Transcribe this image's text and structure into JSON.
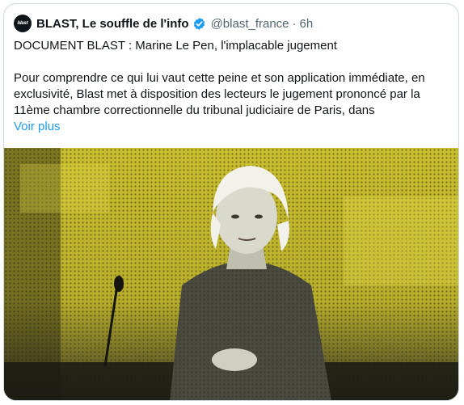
{
  "tweet": {
    "author_name": "BLAST, Le souffle de l'info",
    "avatar_text": "blast",
    "handle": "@blast_france",
    "separator": "·",
    "time": "6h",
    "title": "DOCUMENT BLAST : Marine Le Pen, l'implacable jugement",
    "body_lines": [
      "Pour comprendre ce qui lui vaut cette peine et son application immédiate, en",
      "exclusivité, Blast met à disposition des lecteurs le jugement prononcé par la",
      "11ème chambre correctionnelle du tribunal judiciaire de Paris, dans"
    ],
    "see_more": "Voir plus"
  },
  "icons": {
    "verified": "verified-badge-icon"
  },
  "colors": {
    "accent": "#1d9bf0",
    "image_tint": "#d4c83a",
    "text_secondary": "#536471"
  }
}
